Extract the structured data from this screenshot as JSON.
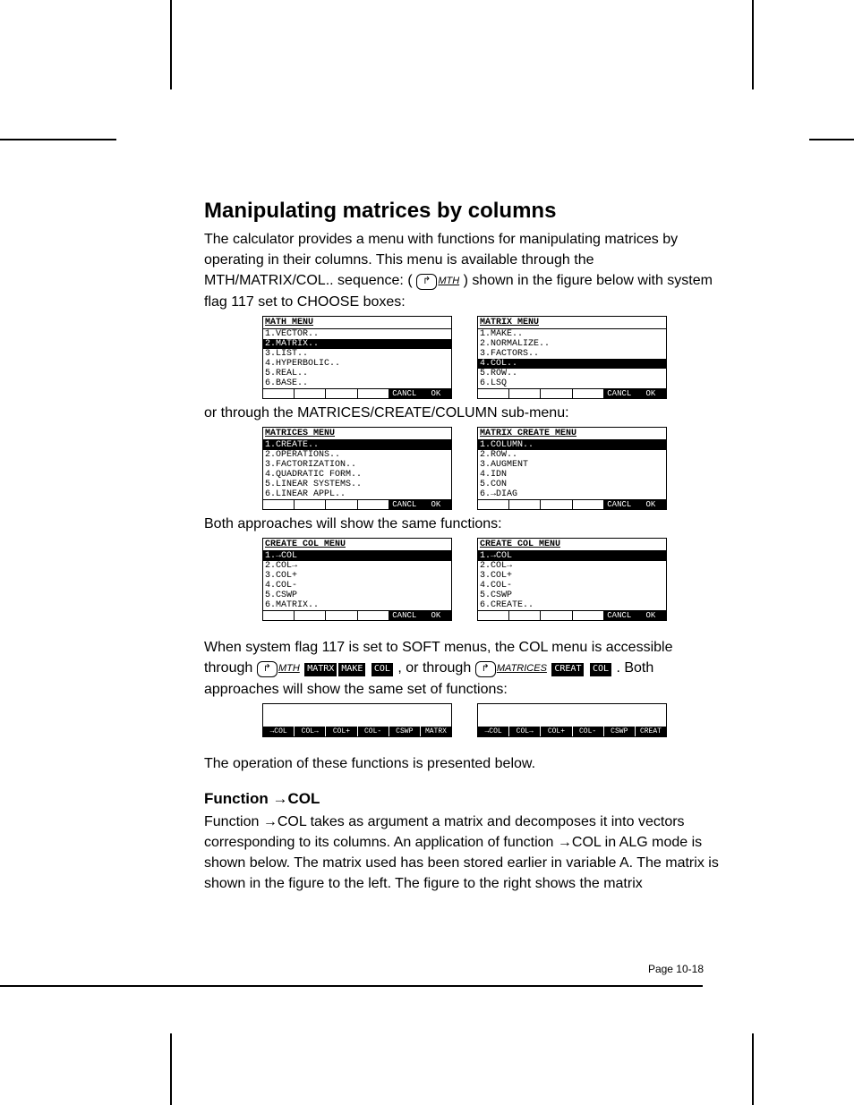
{
  "heading": "Manipulating matrices by columns",
  "para1a": "The calculator provides a menu with functions for manipulating matrices by operating in their columns.  This menu is available through the MTH/MATRIX/COL.. sequence: (",
  "para1b": ") shown in the figure below with system flag 117 set to CHOOSE boxes:",
  "key_shift_glyph": "↱",
  "key_mth": "MTH",
  "key_matrices": "MATRICES",
  "soft_matrx": "MATRX",
  "soft_make": "MAKE",
  "soft_col": "COL",
  "soft_creat": "CREAT",
  "screens1": {
    "left": {
      "title": "MATH MENU",
      "items": [
        "1.VECTOR..",
        "2.MATRIX..",
        "3.LIST..",
        "4.HYPERBOLIC..",
        "5.REAL..",
        "6.BASE.."
      ],
      "selected": 1,
      "soft": [
        "",
        "",
        "",
        "",
        "CANCL",
        "OK"
      ]
    },
    "right": {
      "title": "MATRIX MENU",
      "items": [
        "1.MAKE..",
        "2.NORMALIZE..",
        "3.FACTORS..",
        "4.COL..",
        "5.ROW..",
        "6.LSQ"
      ],
      "selected": 3,
      "soft": [
        "",
        "",
        "",
        "",
        "CANCL",
        "OK"
      ]
    }
  },
  "para2": "or through the MATRICES/CREATE/COLUMN sub-menu:",
  "screens2": {
    "left": {
      "title": "MATRICES MENU",
      "items": [
        "1.CREATE..",
        "2.OPERATIONS..",
        "3.FACTORIZATION..",
        "4.QUADRATIC FORM..",
        "5.LINEAR SYSTEMS..",
        "6.LINEAR APPL.."
      ],
      "selected": 0,
      "soft": [
        "",
        "",
        "",
        "",
        "CANCL",
        "OK"
      ]
    },
    "right": {
      "title": "MATRIX CREATE MENU",
      "items": [
        "1.COLUMN..",
        "2.ROW..",
        "3.AUGMENT",
        "4.IDN",
        "5.CON",
        "6.→DIAG"
      ],
      "selected": 0,
      "soft": [
        "",
        "",
        "",
        "",
        "CANCL",
        "OK"
      ]
    }
  },
  "para3": "Both approaches will show the same functions:",
  "screens3": {
    "left": {
      "title": "CREATE COL MENU",
      "items": [
        "1.→COL",
        "2.COL→",
        "3.COL+",
        "4.COL-",
        "5.CSWP",
        "6.MATRIX.."
      ],
      "selected": 0,
      "soft": [
        "",
        "",
        "",
        "",
        "CANCL",
        "OK"
      ]
    },
    "right": {
      "title": "CREATE COL MENU",
      "items": [
        "1.→COL",
        "2.COL→",
        "3.COL+",
        "4.COL-",
        "5.CSWP",
        "6.CREATE.."
      ],
      "selected": 0,
      "soft": [
        "",
        "",
        "",
        "",
        "CANCL",
        "OK"
      ]
    }
  },
  "para4a": "When system flag 117 is set to SOFT menus, the COL menu is accessible through ",
  "para4b": ", or through ",
  "para4c": ".  Both approaches will show the same set of functions:",
  "screens4": {
    "left": {
      "soft": [
        "→COL",
        "COL→",
        "COL+",
        "COL-",
        "CSWP",
        "MATRX"
      ]
    },
    "right": {
      "soft": [
        "→COL",
        "COL→",
        "COL+",
        "COL-",
        "CSWP",
        "CREAT"
      ]
    }
  },
  "para5": "The operation of these functions is presented below.",
  "subheading": "Function →COL",
  "para6": "Function →COL takes as argument a matrix and decomposes it into vectors corresponding to its columns.  An application of function →COL in ALG mode is shown below.  The matrix used has been stored earlier in variable A.  The matrix is shown in the figure to the left. The figure to the right shows the matrix",
  "footer": "Page 10-18"
}
